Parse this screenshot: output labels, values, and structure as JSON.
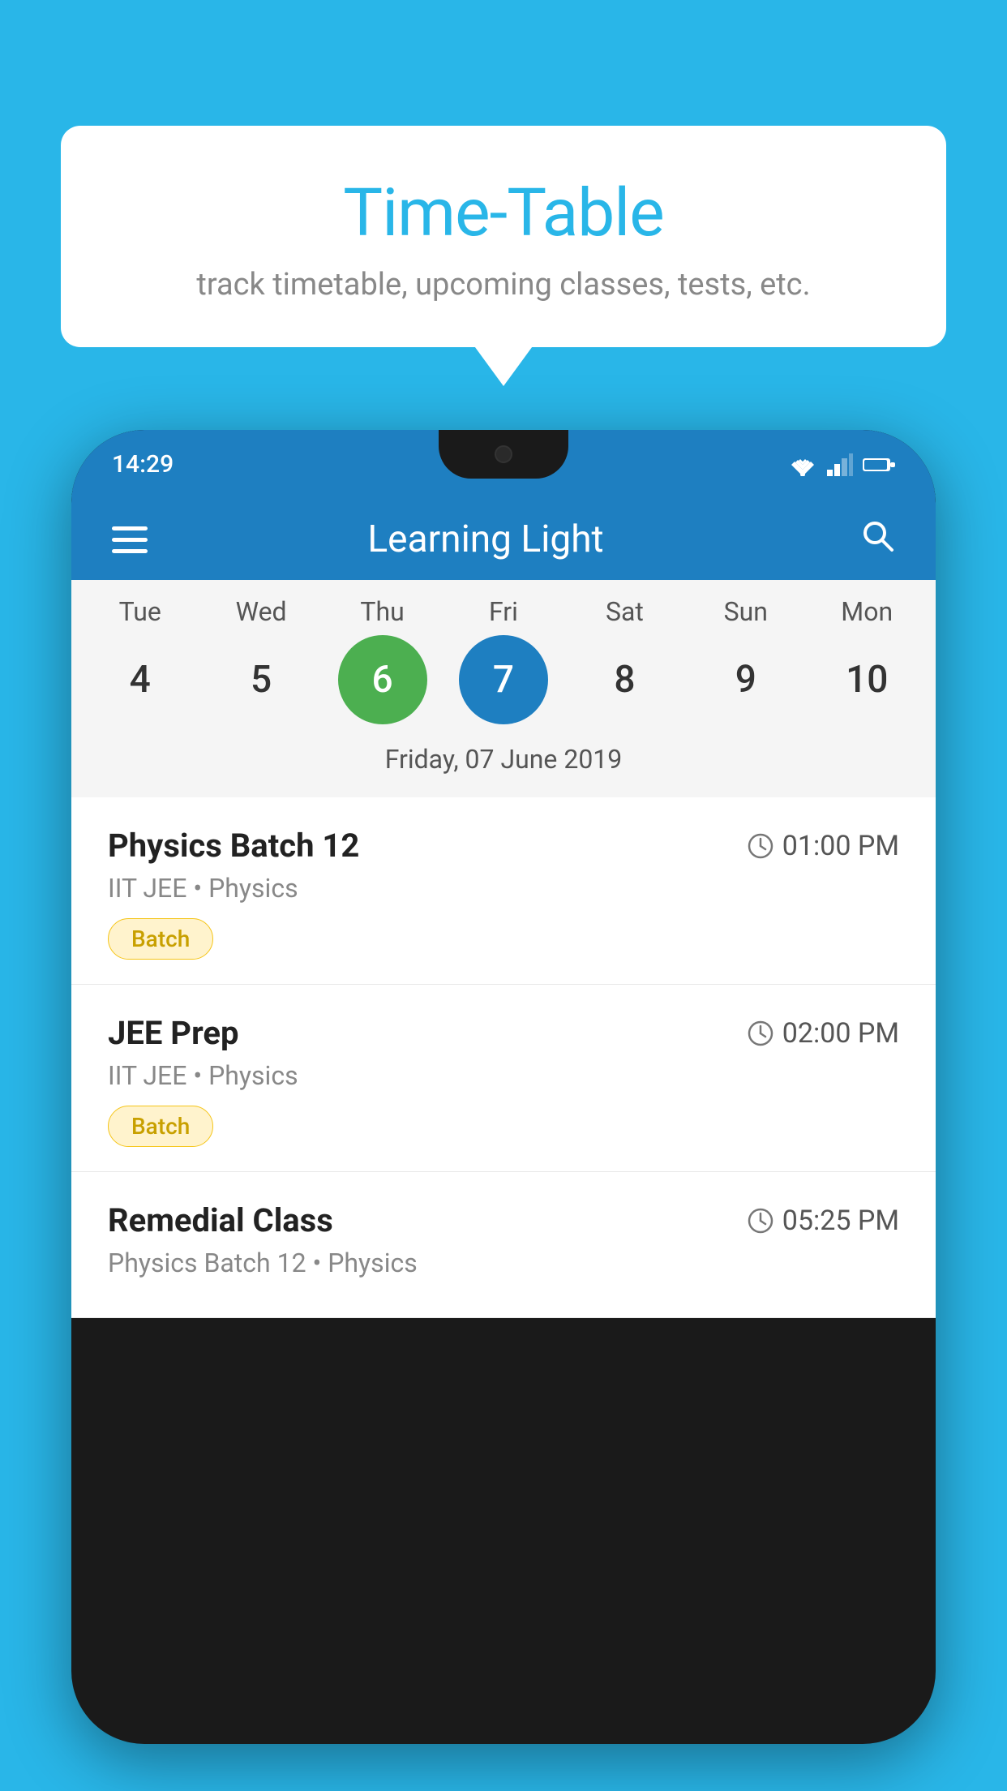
{
  "background": {
    "color": "#29b6e8"
  },
  "bubble": {
    "title": "Time-Table",
    "subtitle": "track timetable, upcoming classes, tests, etc."
  },
  "phone": {
    "status_bar": {
      "time": "14:29"
    },
    "app_bar": {
      "title": "Learning Light"
    },
    "calendar": {
      "days": [
        {
          "short": "Tue",
          "num": "4"
        },
        {
          "short": "Wed",
          "num": "5"
        },
        {
          "short": "Thu",
          "num": "6",
          "state": "today"
        },
        {
          "short": "Fri",
          "num": "7",
          "state": "selected"
        },
        {
          "short": "Sat",
          "num": "8"
        },
        {
          "short": "Sun",
          "num": "9"
        },
        {
          "short": "Mon",
          "num": "10"
        }
      ],
      "selected_date_label": "Friday, 07 June 2019"
    },
    "schedule": [
      {
        "name": "Physics Batch 12",
        "time": "01:00 PM",
        "detail": "IIT JEE • Physics",
        "badge": "Batch"
      },
      {
        "name": "JEE Prep",
        "time": "02:00 PM",
        "detail": "IIT JEE • Physics",
        "badge": "Batch"
      },
      {
        "name": "Remedial Class",
        "time": "05:25 PM",
        "detail": "Physics Batch 12 • Physics",
        "badge": null
      }
    ]
  }
}
